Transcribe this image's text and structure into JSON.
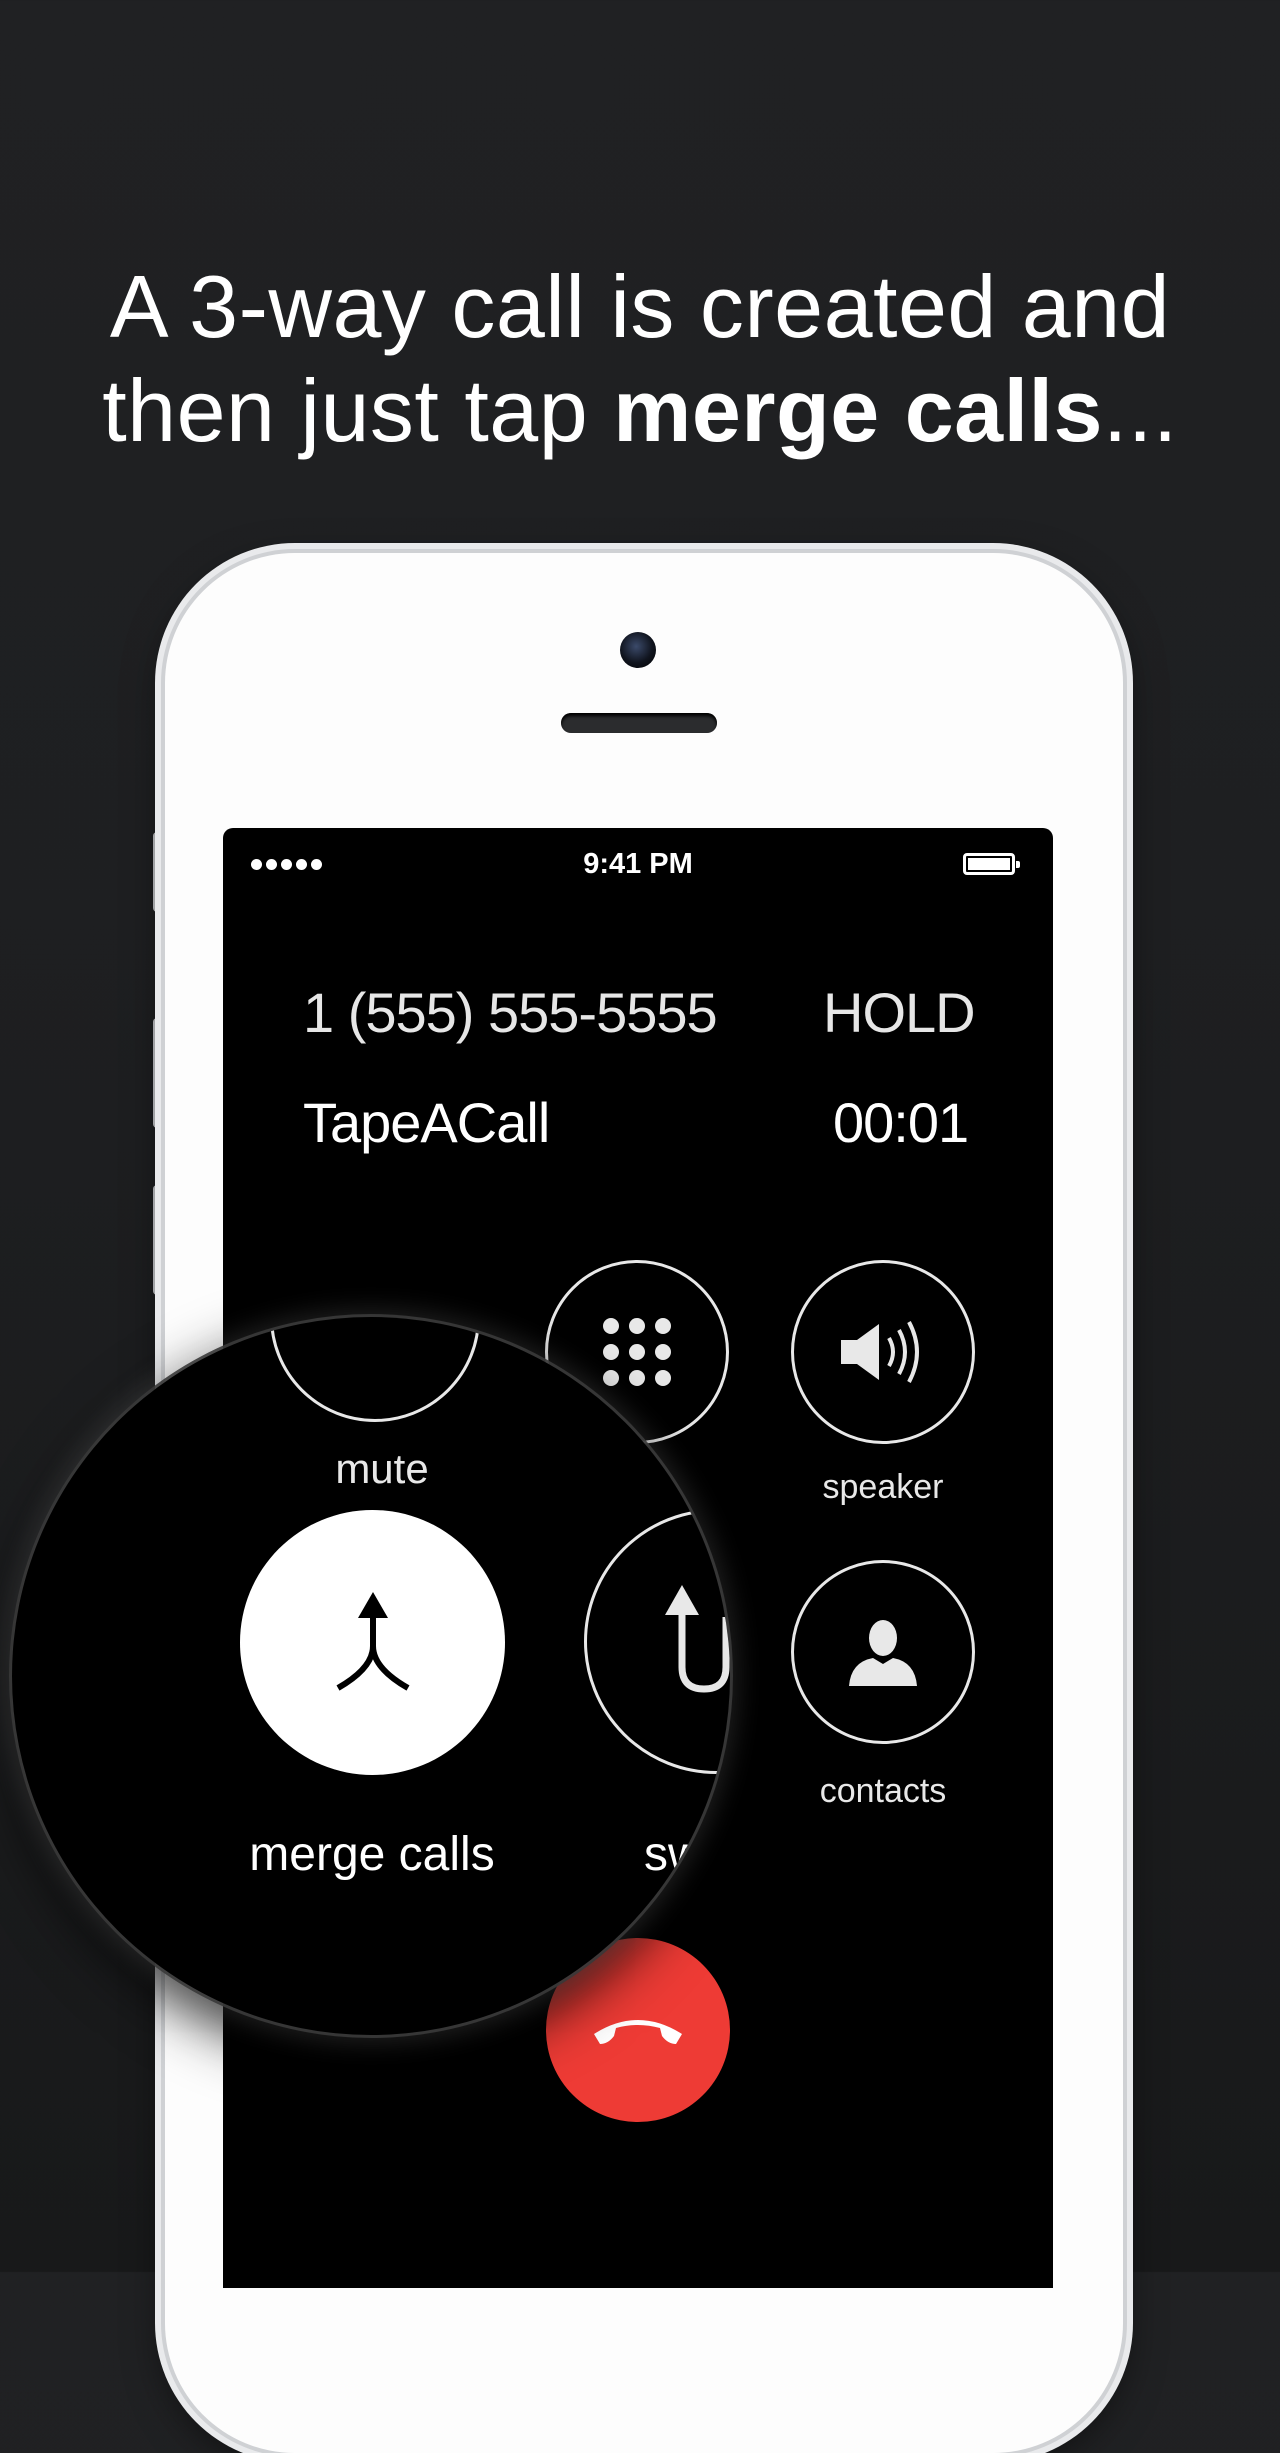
{
  "headline": {
    "line1": "A 3-way call is created and",
    "line2_prefix": "then just tap ",
    "line2_bold": "merge calls",
    "line2_suffix": "..."
  },
  "status_bar": {
    "time": "9:41 PM"
  },
  "calls": {
    "held_number": "1 (555) 555-5555",
    "held_status": "HOLD",
    "active_name": "TapeACall",
    "active_timer": "00:01"
  },
  "controls": {
    "mute": "mute",
    "keypad_partial": "d",
    "speaker": "speaker",
    "merge_calls": "merge calls",
    "swap_partial": "sw",
    "contacts": "contacts"
  },
  "colors": {
    "end_call": "#ee3b35",
    "screen": "#000000",
    "background": "#1f2022"
  },
  "icons": [
    "merge-icon",
    "keypad-icon",
    "speaker-icon",
    "swap-icon",
    "contacts-icon",
    "end-call-icon"
  ]
}
